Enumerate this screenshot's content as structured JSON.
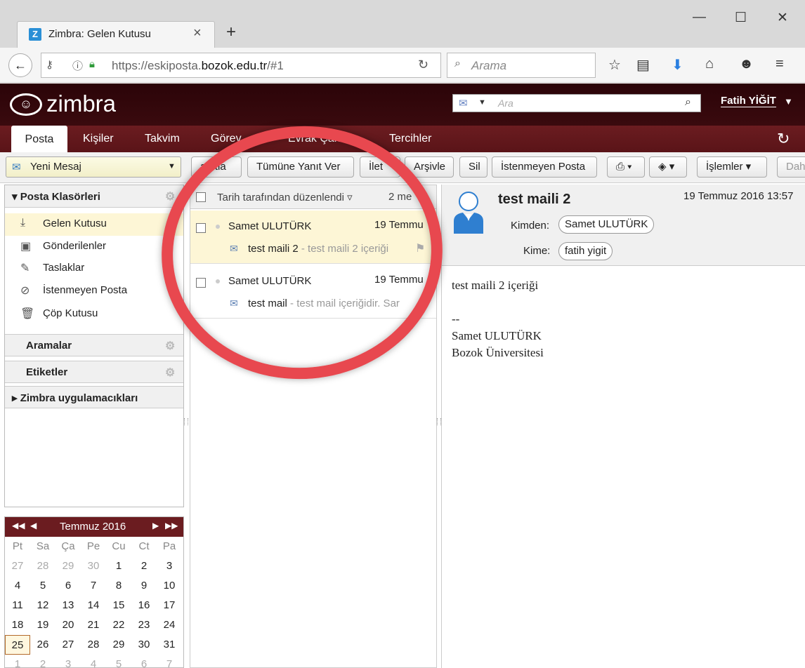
{
  "browser": {
    "tab_title": "Zimbra: Gelen Kutusu",
    "favicon_letter": "Z",
    "url_prefix": "https://eskiposta.",
    "url_domain": "bozok.edu.tr",
    "url_suffix": "/#1",
    "search_placeholder": "Arama"
  },
  "header": {
    "logo": "zimbra",
    "search_placeholder": "Ara",
    "user": "Fatih YİĞİT"
  },
  "app_tabs": [
    "Posta",
    "Kişiler",
    "Takvim",
    "Görev",
    "Evrak Çantası",
    "Tercihler"
  ],
  "toolbar": {
    "new_message": "Yeni Mesaj",
    "buttons": [
      "Yanıtla",
      "Tümüne Yanıt Ver",
      "İlet",
      "Arşivle",
      "Sil",
      "İstenmeyen Posta",
      "İşlemler",
      "Dah"
    ],
    "visible_partial": {
      "reply": "anıtla",
      "forward": "İlet"
    }
  },
  "sidebar": {
    "folders_header": "Posta Klasörleri",
    "folders": [
      "Gelen Kutusu",
      "Gönderilenler",
      "Taslaklar",
      "İstenmeyen Posta",
      "Çöp Kutusu"
    ],
    "searches": "Aramalar",
    "tags": "Etiketler",
    "zimlets": "Zimbra uygulamacıkları"
  },
  "calendar": {
    "title": "Temmuz 2016",
    "dow": [
      "Pt",
      "Sa",
      "Ça",
      "Pe",
      "Cu",
      "Ct",
      "Pa"
    ],
    "weeks": [
      [
        "27",
        "28",
        "29",
        "30",
        "1",
        "2",
        "3"
      ],
      [
        "4",
        "5",
        "6",
        "7",
        "8",
        "9",
        "10"
      ],
      [
        "11",
        "12",
        "13",
        "14",
        "15",
        "16",
        "17"
      ],
      [
        "18",
        "19",
        "20",
        "21",
        "22",
        "23",
        "24"
      ],
      [
        "25",
        "26",
        "27",
        "28",
        "29",
        "30",
        "31"
      ],
      [
        "1",
        "2",
        "3",
        "4",
        "5",
        "6",
        "7"
      ]
    ],
    "today": "25"
  },
  "message_list": {
    "sort_label": "Tarih tarafından düzenlendi",
    "count": "2 me",
    "rows": [
      {
        "from": "Samet ULUTÜRK",
        "date": "19 Temmu",
        "subject": "test maili 2",
        "fragment": " - test maili 2 içeriği"
      },
      {
        "from": "Samet ULUTÜRK",
        "date": "19 Temmu",
        "subject": "test mail",
        "fragment": " - test mail içeriğidir. Sar"
      }
    ]
  },
  "reading_pane": {
    "subject": "test maili 2",
    "date": "19 Temmuz 2016 13:57",
    "from_label": "Kimden:",
    "from": "Samet ULUTÜRK",
    "to_label": "Kime:",
    "to": "fatih yigit",
    "body": [
      "test maili 2 içeriği",
      "",
      "--",
      "Samet ULUTÜRK",
      "Bozok Üniversitesi"
    ]
  },
  "colors": {
    "zimbra_dark": "#2b0408",
    "tab_bar": "#6b1c20",
    "highlight": "#fdf6d6",
    "circle": "#e8484f"
  }
}
